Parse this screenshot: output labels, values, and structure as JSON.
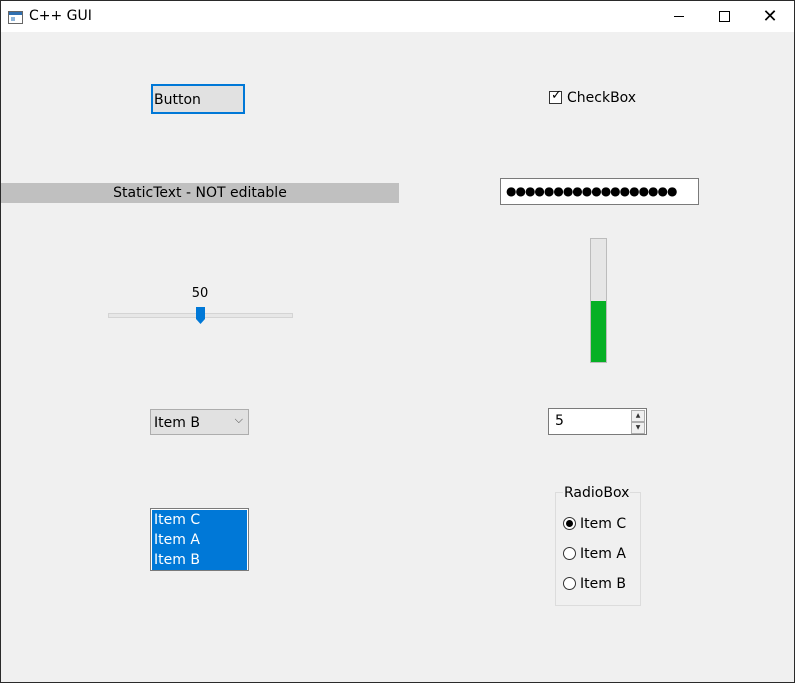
{
  "window": {
    "title": "C++ GUI",
    "close_glyph": "✕"
  },
  "button": {
    "label": "Button"
  },
  "checkbox": {
    "label": "CheckBox",
    "checked": true
  },
  "static_text": {
    "text": "StaticText - NOT editable"
  },
  "password": {
    "value": "●●●●●●●●●●●●●●●●●●"
  },
  "slider": {
    "value": "50"
  },
  "progress": {
    "value_percent": 50,
    "color": "#06b025"
  },
  "combo": {
    "selected": "Item B",
    "arrow": "⌵"
  },
  "spin": {
    "value": "5",
    "up": "▲",
    "down": "▼"
  },
  "listbox": {
    "items": [
      "Item C",
      "Item A",
      "Item B"
    ]
  },
  "radio": {
    "legend": "RadioBox",
    "options": [
      "Item C",
      "Item A",
      "Item B"
    ],
    "selected": "Item C"
  },
  "colors": {
    "accent": "#0078d7",
    "window_bg": "#f0f0f0",
    "static_bg": "#c0c0c0"
  },
  "icons": {
    "app": "window-app-icon",
    "check": "check-icon",
    "combo": "chevron-down-icon"
  }
}
